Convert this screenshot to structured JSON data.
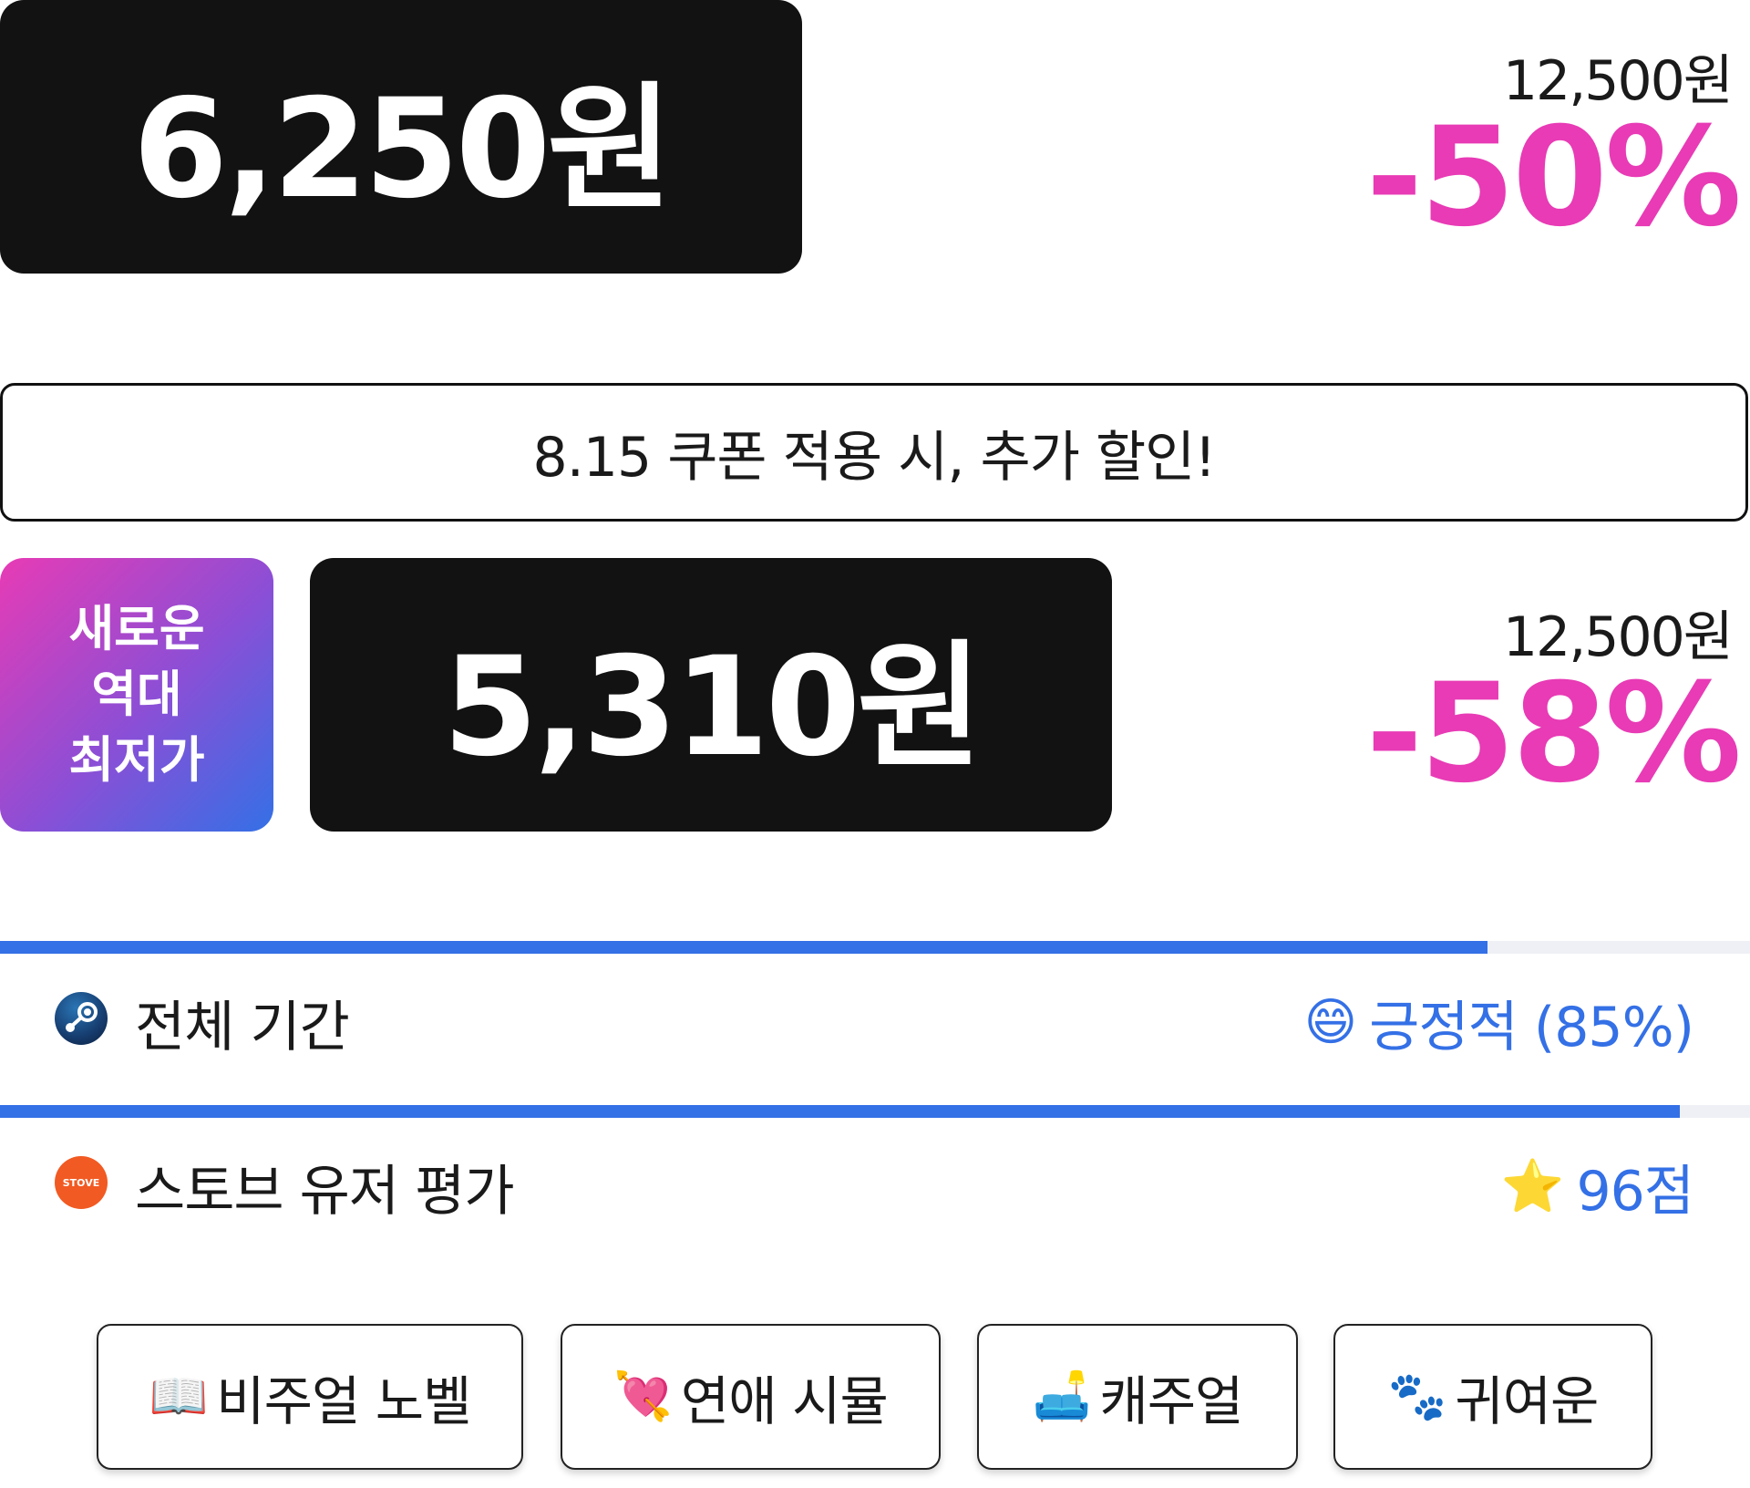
{
  "offer_1": {
    "price": "6,250원",
    "original_price": "12,500원",
    "discount": "-50%"
  },
  "coupon_banner": "8.15 쿠폰 적용 시, 추가 할인!",
  "offer_2": {
    "badge_lines": [
      "새로운",
      "역대",
      "최저가"
    ],
    "price": "5,310원",
    "original_price": "12,500원",
    "discount": "-58%"
  },
  "ratings": [
    {
      "icon": "steam-icon",
      "label": "전체 기간",
      "emoji": "😄",
      "value": "긍정적 (85%)",
      "bar_fill_fraction": 0.85
    },
    {
      "icon": "stove-icon",
      "icon_text": "STOVE",
      "label": "스토브 유저 평가",
      "emoji": "⭐",
      "value": "96점",
      "bar_fill_fraction": 0.96
    }
  ],
  "tags": [
    {
      "emoji": "📖",
      "label": "비주얼 노벨"
    },
    {
      "emoji": "💘",
      "label": "연애 시뮬"
    },
    {
      "emoji": "🛋️",
      "label": "캐주얼"
    },
    {
      "emoji": "🐾",
      "label": "귀여운"
    }
  ],
  "colors": {
    "price_box_bg": "#121212",
    "discount": "#e83bb5",
    "accent_blue": "#3470e6",
    "badge_gradient_start": "#e83bb5",
    "badge_gradient_end": "#3470e6",
    "stove_orange": "#f15a22"
  }
}
